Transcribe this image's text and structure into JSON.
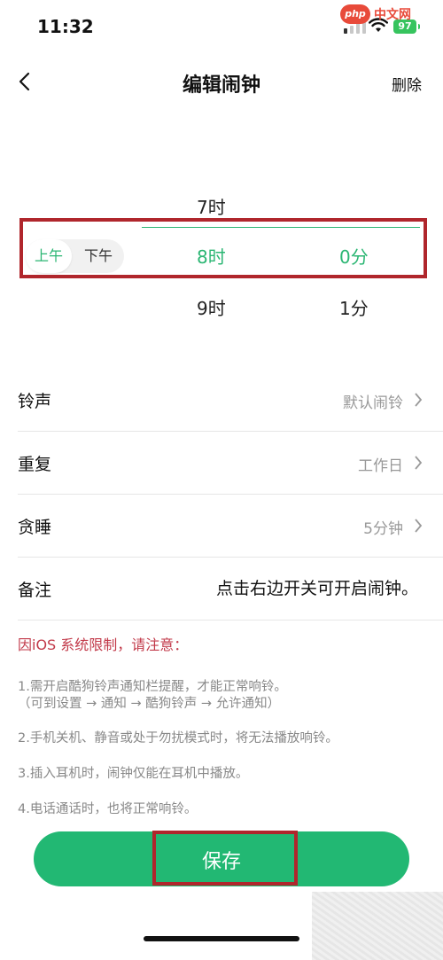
{
  "status_bar": {
    "time": "11:32",
    "battery": "97"
  },
  "watermark": {
    "logo": "php",
    "text": "中文网"
  },
  "nav": {
    "title": "编辑闹钟",
    "delete_label": "删除"
  },
  "picker": {
    "hours": [
      "7时",
      "8时",
      "9时"
    ],
    "minutes": [
      "0分",
      "1分"
    ],
    "selected_hour": "8时",
    "selected_minute": "0分",
    "am_label": "上午",
    "pm_label": "下午",
    "selected_period": "上午"
  },
  "settings": {
    "ringtone": {
      "label": "铃声",
      "value": "默认闹铃"
    },
    "repeat": {
      "label": "重复",
      "value": "工作日"
    },
    "snooze": {
      "label": "贪睡",
      "value": "5分钟"
    },
    "note": {
      "label": "备注",
      "value": "点击右边开关可开启闹钟。"
    }
  },
  "notice": {
    "title": "因iOS 系统限制，请注意：",
    "items": [
      "1.需开启酷狗铃声通知栏提醒，才能正常响铃。",
      "（可到设置 → 通知 → 酷狗铃声 → 允许通知）",
      "2.手机关机、静音或处于勿扰模式时，将无法播放响铃。",
      "3.插入耳机时，闹钟仅能在耳机中播放。",
      "4.电话通话时，也将正常响铃。"
    ]
  },
  "save_button": {
    "label": "保存"
  },
  "colors": {
    "accent": "#22b873",
    "highlight_border": "#b0262c",
    "notice": "#c23a4a"
  }
}
